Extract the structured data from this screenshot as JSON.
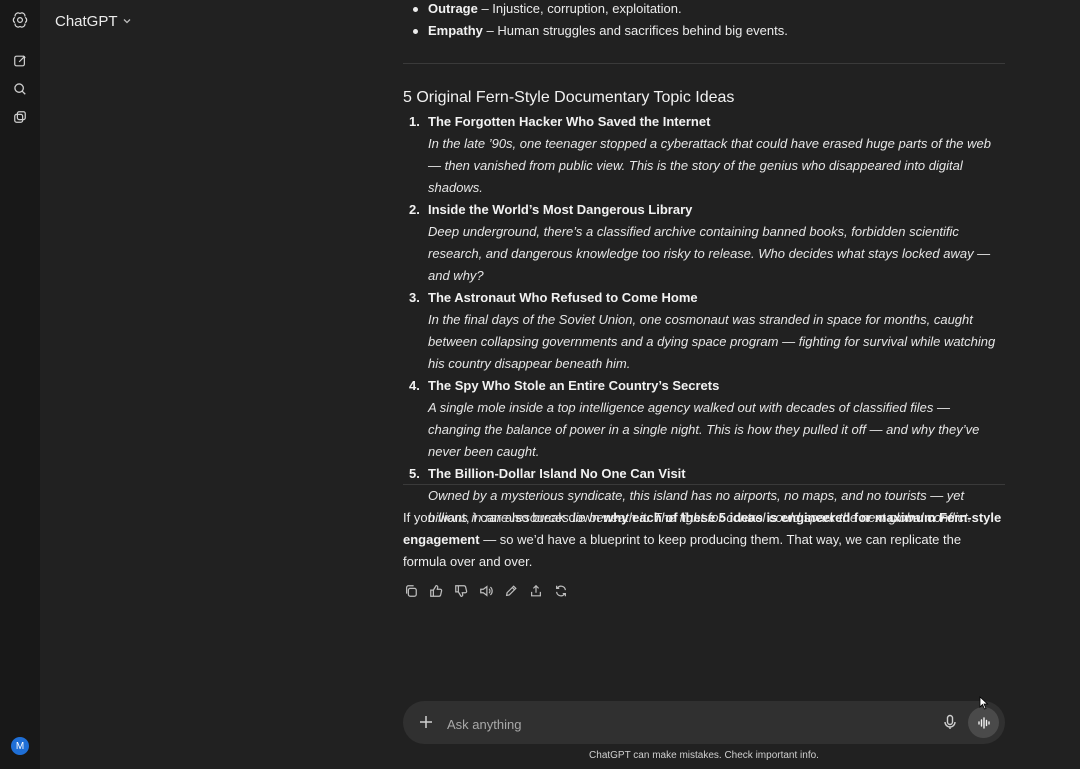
{
  "app": {
    "model_name": "ChatGPT",
    "avatar_initial": "M"
  },
  "sidebar": {
    "icons": [
      "openai-logo-icon",
      "new-chat-icon",
      "search-icon",
      "library-icon"
    ]
  },
  "bullets": [
    {
      "term": "Outrage",
      "text": " – Injustice, corruption, exploitation."
    },
    {
      "term": "Empathy",
      "text": " – Human struggles and sacrifices behind big events."
    }
  ],
  "section": {
    "heading": "5 Original Fern-Style Documentary Topic Ideas",
    "items": [
      {
        "num": "1.",
        "title": "The Forgotten Hacker Who Saved the Internet",
        "desc": "In the late ’90s, one teenager stopped a cyberattack that could have erased huge parts of the web — then vanished from public view. This is the story of the genius who disappeared into digital shadows."
      },
      {
        "num": "2.",
        "title": "Inside the World’s Most Dangerous Library",
        "desc": "Deep underground, there’s a classified archive containing banned books, forbidden scientific research, and dangerous knowledge too risky to release. Who decides what stays locked away — and why?"
      },
      {
        "num": "3.",
        "title": "The Astronaut Who Refused to Come Home",
        "desc": "In the final days of the Soviet Union, one cosmonaut was stranded in space for months, caught between collapsing governments and a dying space program — fighting for survival while watching his country disappear beneath him."
      },
      {
        "num": "4.",
        "title": "The Spy Who Stole an Entire Country’s Secrets",
        "desc": "A single mole inside a top intelligence agency walked out with decades of classified files — changing the balance of power in a single night. This is how they pulled it off — and why they’ve never been caught."
      },
      {
        "num": "5.",
        "title": "The Billion-Dollar Island No One Can Visit",
        "desc": "Owned by a mysterious syndicate, this island has no airports, no maps, and no tourists — yet billions in rare resources lie beneath it. The fight for control could spark the next global conflict."
      }
    ]
  },
  "closing": {
    "pre": "If you want, I can also break down ",
    "bold": "why each of these 5 ideas is engineered for maximum Fern-style engagement",
    "post": " — so we’d have a blueprint to keep producing them. That way, we can replicate the formula over and over."
  },
  "actions": [
    "copy-icon",
    "thumbs-up-icon",
    "thumbs-down-icon",
    "read-aloud-icon",
    "edit-icon",
    "share-icon",
    "regenerate-icon"
  ],
  "composer": {
    "placeholder": "Ask anything"
  },
  "footer": {
    "disclaimer": "ChatGPT can make mistakes. Check important info."
  }
}
